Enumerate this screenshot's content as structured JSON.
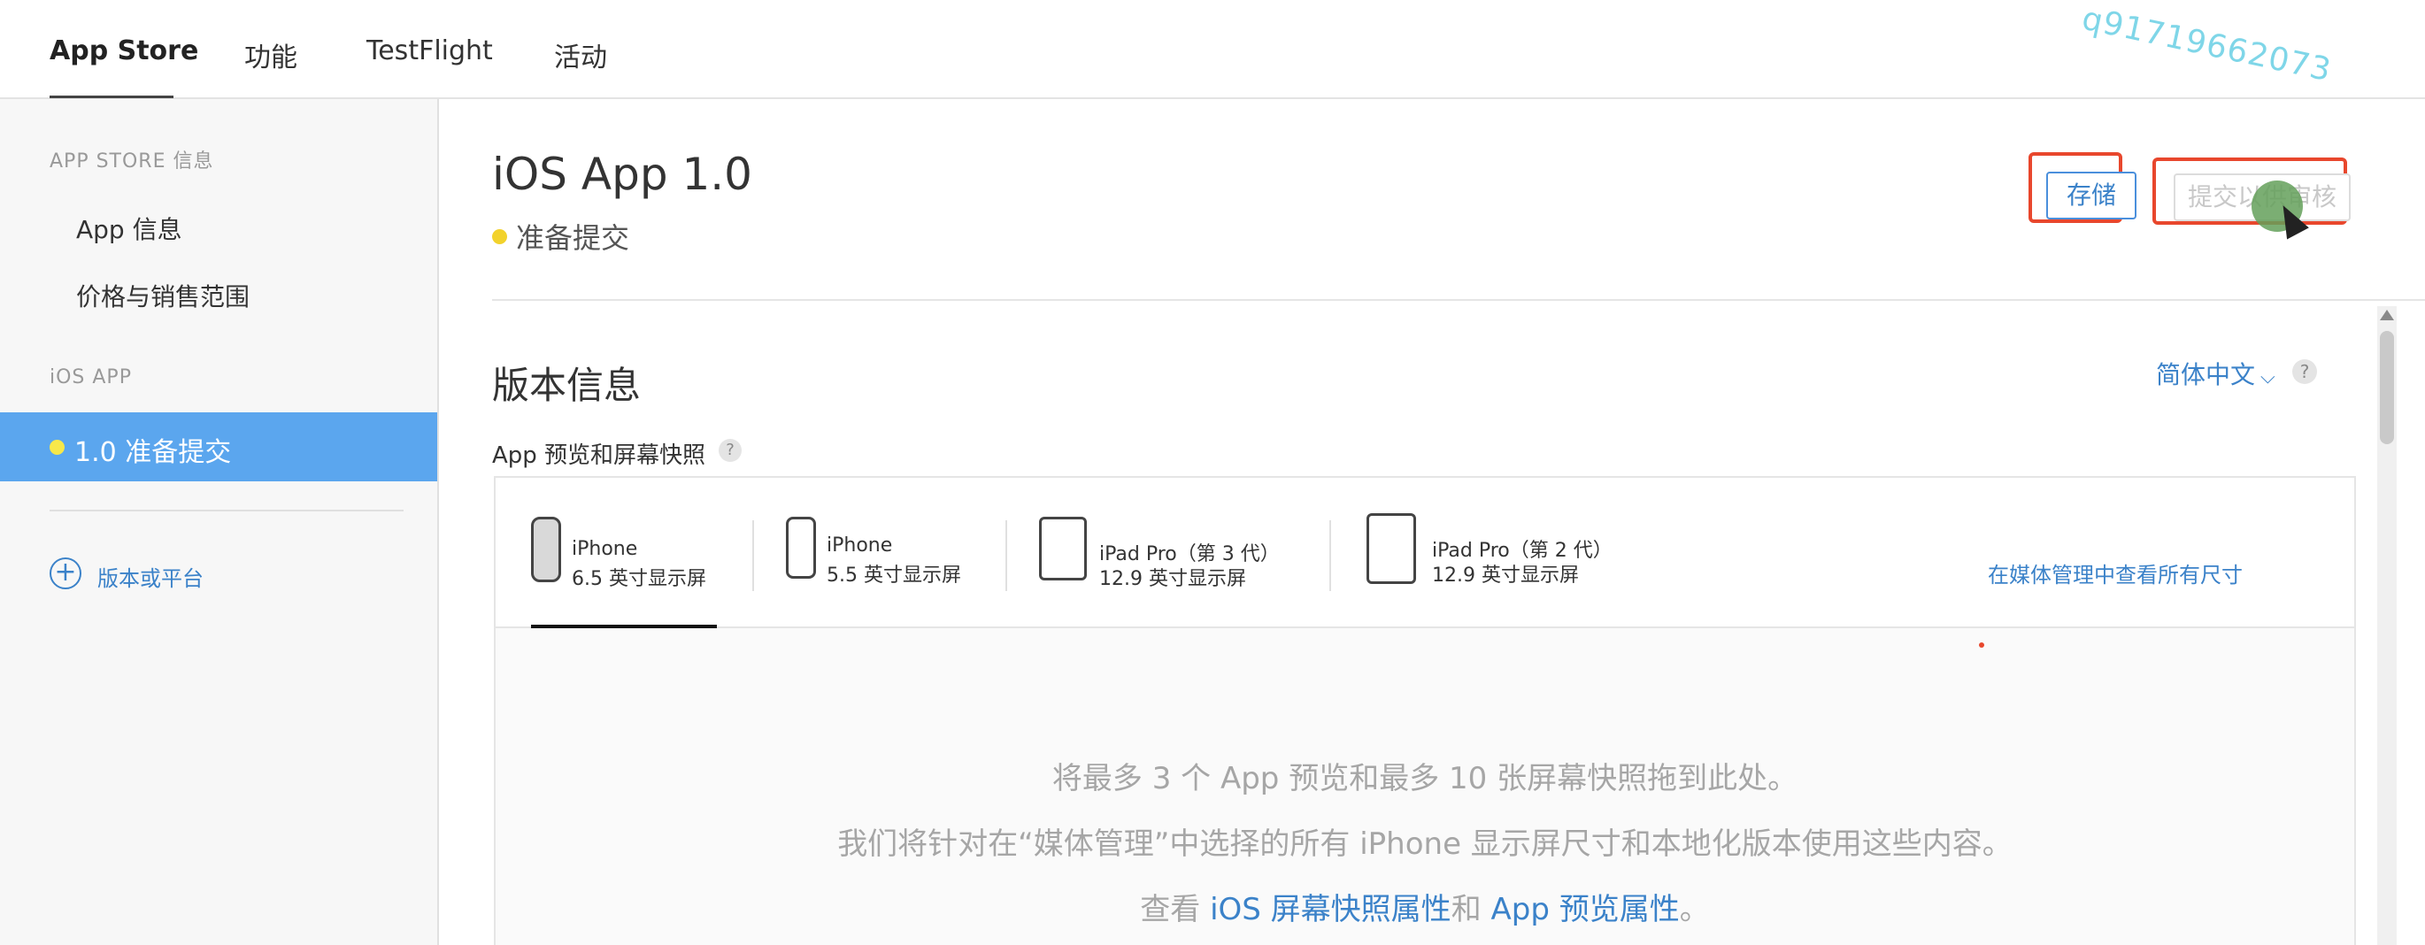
{
  "topnav": {
    "tabs": [
      {
        "label": "App Store"
      },
      {
        "label": "功能"
      },
      {
        "label": "TestFlight"
      },
      {
        "label": "活动"
      }
    ],
    "watermark": "q91719662073"
  },
  "sidebar": {
    "section_store": "APP STORE 信息",
    "items_store": [
      {
        "label": "App 信息"
      },
      {
        "label": "价格与销售范围"
      }
    ],
    "section_ios": "iOS APP",
    "active_version": "1.0 准备提交",
    "add_version": "版本或平台"
  },
  "main": {
    "app_title": "iOS App 1.0",
    "status": "准备提交",
    "save_button": "存储",
    "submit_button": "提交以供审核",
    "section_title": "版本信息",
    "language": "简体中文",
    "subsection": "App 预览和屏幕快照",
    "devices": [
      {
        "name": "iPhone",
        "size": "6.5 英寸显示屏"
      },
      {
        "name": "iPhone",
        "size": "5.5 英寸显示屏"
      },
      {
        "name": "iPad Pro（第 3 代）",
        "size": "12.9 英寸显示屏"
      },
      {
        "name": "iPad Pro（第 2 代）",
        "size": "12.9 英寸显示屏"
      }
    ],
    "media_link": "在媒体管理中查看所有尺寸",
    "drop_line1": "将最多 3 个 App 预览和最多 10 张屏幕快照拖到此处。",
    "drop_line2": "我们将针对在“媒体管理”中选择的所有 iPhone 显示屏尺寸和本地化版本使用这些内容。",
    "drop_line3_prefix": "查看 ",
    "drop_link1": "iOS 屏幕快照属性",
    "drop_line3_mid": "和 ",
    "drop_link2": "App 预览属性",
    "drop_line3_suffix": "。"
  },
  "colors": {
    "accent": "#3b82c9",
    "active_sidebar": "#5ba6ee",
    "status_dot": "#f2d22c",
    "highlight_box": "#e8472d"
  }
}
